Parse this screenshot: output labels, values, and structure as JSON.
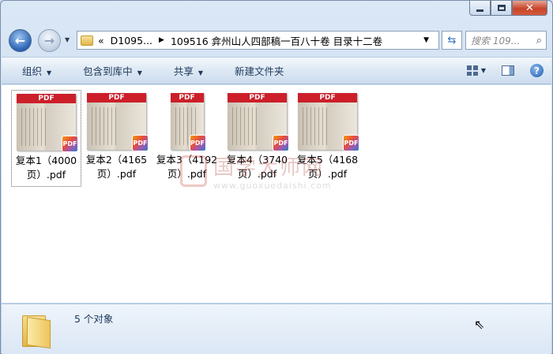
{
  "window": {
    "min_label": "—",
    "max_label": "□",
    "close_label": "✕"
  },
  "address": {
    "overflow": "«",
    "crumbs": [
      "D1095...",
      "109516 弇州山人四部稿一百八十卷 目录十二卷"
    ]
  },
  "search": {
    "placeholder": "搜索 109..."
  },
  "toolbar": {
    "organize": "组织",
    "include_library": "包含到库中",
    "share": "共享",
    "new_folder": "新建文件夹"
  },
  "files": [
    {
      "name": "复本1（4000页）.pdf",
      "badge": "PDF",
      "band": "PDF"
    },
    {
      "name": "复本2（4165页）.pdf",
      "badge": "PDF",
      "band": "PDF"
    },
    {
      "name": "复本3（4192页）.pdf",
      "badge": "PDF",
      "band": "PDF"
    },
    {
      "name": "复本4（3740页）.pdf",
      "badge": "PDF",
      "band": "PDF"
    },
    {
      "name": "复本5（4168页）.pdf",
      "badge": "PDF",
      "band": "PDF"
    }
  ],
  "watermark": {
    "title": "国学大师网",
    "url": "www.guoxuedaishi.com"
  },
  "status": {
    "count": "5 个对象"
  },
  "colors": {
    "pdf_band": "#cc1f2a",
    "window_bg": "#c9daee"
  }
}
